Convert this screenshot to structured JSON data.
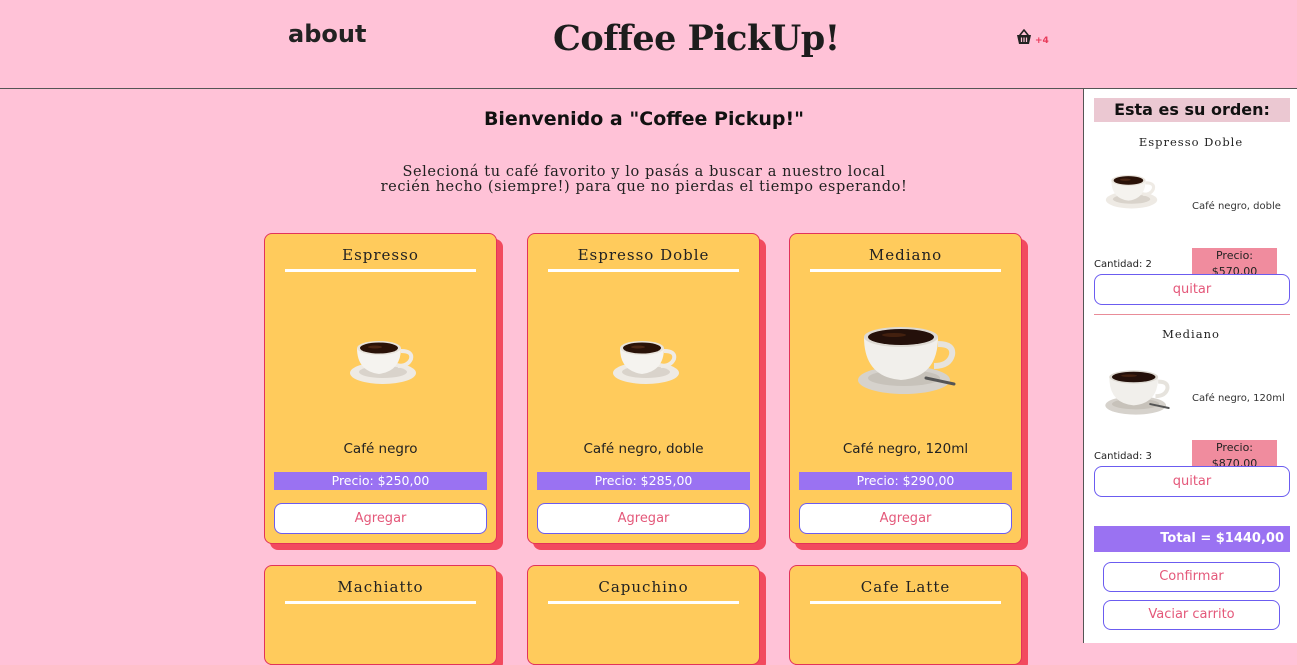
{
  "header": {
    "about_label": "about",
    "title": "Coffee PickUp!",
    "cart_icon": "basket-icon",
    "cart_count": "+4"
  },
  "main": {
    "welcome": "Bienvenido a \"Coffee Pickup!\"",
    "subtitle_line1": "Selecioná tu café favorito y lo pasás a buscar a nuestro local",
    "subtitle_line2": "recién hecho (siempre!) para que no pierdas el tiempo esperando!",
    "products": [
      {
        "name": "Espresso",
        "description": "Café negro",
        "price": "Precio: $250,00",
        "button": "Agregar",
        "image_icon": "small-coffee-cup-icon"
      },
      {
        "name": "Espresso Doble",
        "description": "Café negro, doble",
        "price": "Precio: $285,00",
        "button": "Agregar",
        "image_icon": "small-coffee-cup-icon"
      },
      {
        "name": "Mediano",
        "description": "Café negro, 120ml",
        "price": "Precio: $290,00",
        "button": "Agregar",
        "image_icon": "large-coffee-cup-icon"
      },
      {
        "name": "Machiatto"
      },
      {
        "name": "Capuchino"
      },
      {
        "name": "Cafe Latte"
      }
    ]
  },
  "order": {
    "header": "Esta es su orden:",
    "items": [
      {
        "name": "Espresso Doble",
        "description": "Café negro, doble",
        "price": "Precio: $570,00",
        "quantity": "Cantidad: 2",
        "remove": "quitar",
        "image_icon": "small-coffee-cup-icon"
      },
      {
        "name": "Mediano",
        "description": "Café negro, 120ml",
        "price": "Precio: $870,00",
        "quantity": "Cantidad: 3",
        "remove": "quitar",
        "image_icon": "large-coffee-cup-icon"
      }
    ],
    "total": "Total = $1440,00",
    "confirm": "Confirmar",
    "empty": "Vaciar carrito"
  },
  "colors": {
    "background": "#ffc2d7",
    "card": "#ffcb5c",
    "card_shadow": "#f24a5e",
    "price_bar": "#9a72f2",
    "button_text": "#e4587a",
    "button_border": "#6b5cf0"
  }
}
